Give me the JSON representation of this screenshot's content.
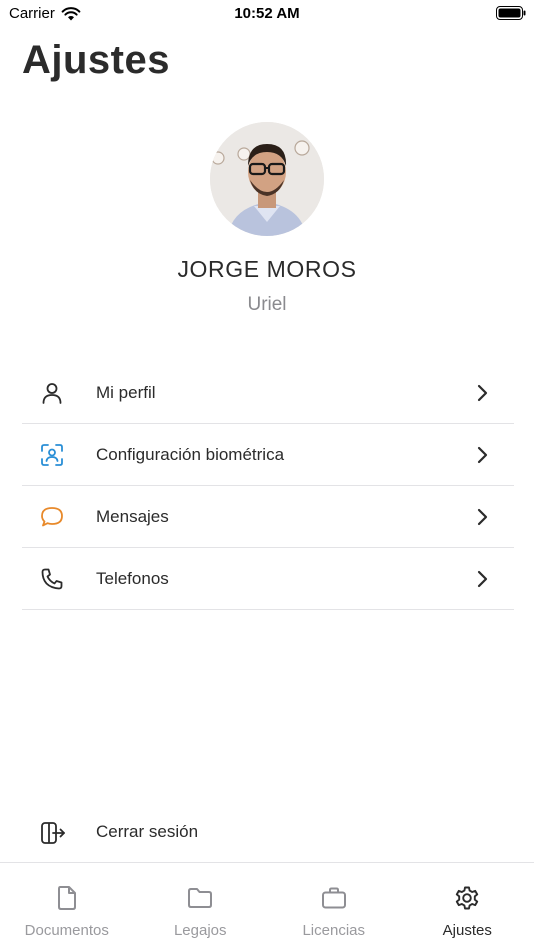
{
  "status_bar": {
    "carrier": "Carrier",
    "time": "10:52 AM"
  },
  "page": {
    "title": "Ajustes"
  },
  "profile": {
    "name": "JORGE MOROS",
    "subtitle": "Uriel"
  },
  "menu": [
    {
      "label": "Mi perfil",
      "icon": "user-icon",
      "color": "#2b2b2b"
    },
    {
      "label": "Configuración biométrica",
      "icon": "face-scan-icon",
      "color": "#2a8fd6"
    },
    {
      "label": "Mensajes",
      "icon": "message-bubble-icon",
      "color": "#e8892a"
    },
    {
      "label": "Telefonos",
      "icon": "phone-icon",
      "color": "#2b2b2b"
    }
  ],
  "logout": {
    "label": "Cerrar sesión",
    "icon": "logout-icon"
  },
  "tabs": [
    {
      "label": "Documentos",
      "icon": "document-icon",
      "active": false
    },
    {
      "label": "Legajos",
      "icon": "folder-icon",
      "active": false
    },
    {
      "label": "Licencias",
      "icon": "briefcase-icon",
      "active": false
    },
    {
      "label": "Ajustes",
      "icon": "gear-icon",
      "active": true
    }
  ]
}
